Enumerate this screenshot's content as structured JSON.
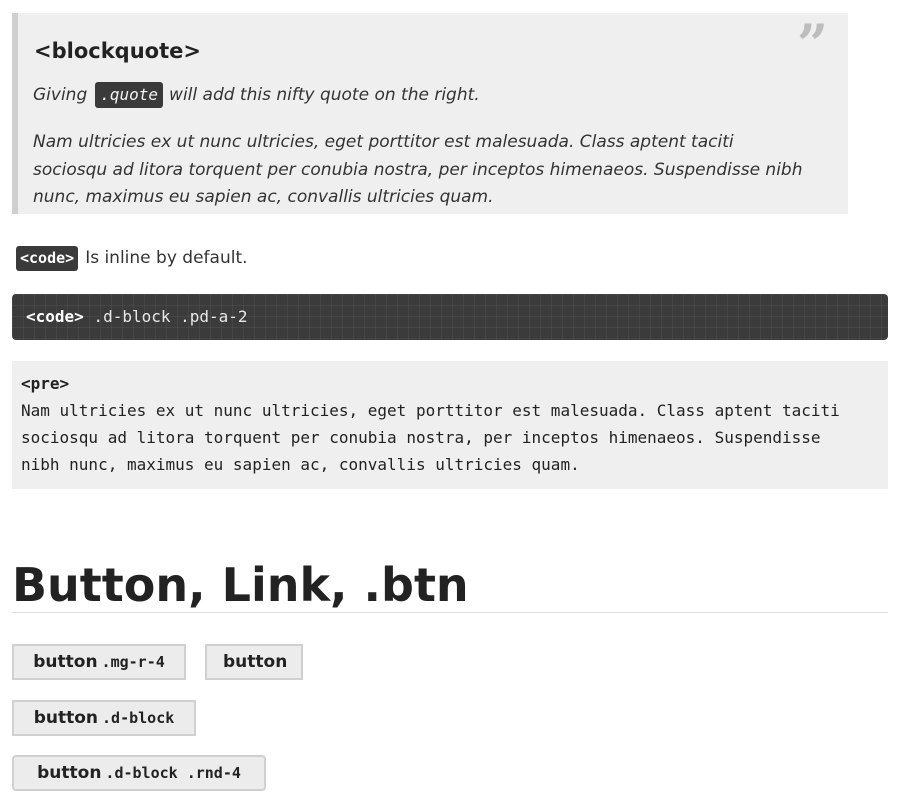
{
  "blockquote": {
    "title": "<blockquote>",
    "quote_mark": "”",
    "intro_before": "Giving",
    "intro_code": ".quote",
    "intro_after": "will add this nifty quote on the right.",
    "paragraph_lines": [
      "Nam ultricies ex ut nunc ultricies, eget porttitor est malesuada. Class aptent taciti",
      "sociosqu ad litora torquent per conubia nostra, per inceptos himenaeos. Suspendisse nibh",
      "nunc, maximus eu sapien ac, convallis ultricies quam."
    ]
  },
  "inline_code": {
    "badge": "<code>",
    "text": "Is inline by default."
  },
  "code_block": {
    "tag": "<code>",
    "classes": " .d-block .pd-a-2"
  },
  "pre_block": {
    "tag": "<pre>",
    "lines": [
      "Nam ultricies ex ut nunc ultricies, eget porttitor est malesuada. Class aptent taciti",
      "sociosqu ad litora torquent per conubia nostra, per inceptos himenaeos. Suspendisse",
      "nibh nunc, maximus eu sapien ac, convallis ultricies quam."
    ]
  },
  "section": {
    "heading": "Button, Link, .btn"
  },
  "buttons": [
    {
      "label": "button",
      "class_text": ".mg-r-4"
    },
    {
      "label": "button",
      "class_text": ""
    },
    {
      "label": "button",
      "class_text": ".d-block"
    },
    {
      "label": "button",
      "class_text": ".d-block .rnd-4"
    }
  ]
}
